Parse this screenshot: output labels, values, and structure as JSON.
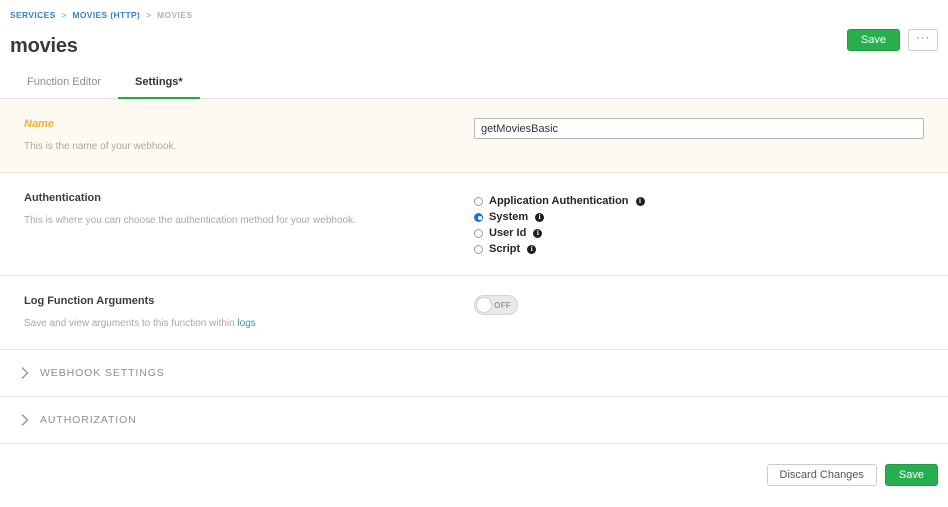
{
  "breadcrumb": {
    "items": [
      {
        "label": "SERVICES",
        "type": "link"
      },
      {
        "label": "MOVIES (HTTP)",
        "type": "link"
      },
      {
        "label": "MOVIES",
        "type": "current"
      }
    ],
    "separator": ">"
  },
  "header": {
    "title": "movies",
    "save_label": "Save",
    "more_label": "···"
  },
  "tabs": [
    {
      "label": "Function Editor",
      "active": false
    },
    {
      "label": "Settings*",
      "active": true
    }
  ],
  "sections": {
    "name": {
      "label": "Name",
      "description": "This is the name of your webhook.",
      "input_value": "getMoviesBasic",
      "input_placeholder": ""
    },
    "authentication": {
      "label": "Authentication",
      "description": "This is where you can choose the authentication method for your webhook.",
      "options": [
        {
          "label": "Application Authentication",
          "selected": false,
          "info": "i"
        },
        {
          "label": "System",
          "selected": true,
          "info": "i"
        },
        {
          "label": "User Id",
          "selected": false,
          "info": "i"
        },
        {
          "label": "Script",
          "selected": false,
          "info": "i"
        }
      ]
    },
    "log_function_arguments": {
      "label": "Log Function Arguments",
      "description_prefix": "Save and view arguments to this function within ",
      "description_link": "logs",
      "toggle_state": "OFF"
    }
  },
  "collapsibles": [
    {
      "label": "WEBHOOK SETTINGS",
      "icon": "chevron-right-icon"
    },
    {
      "label": "AUTHORIZATION",
      "icon": "chevron-right-icon"
    }
  ],
  "footer": {
    "discard_label": "Discard Changes",
    "save_label": "Save"
  },
  "colors": {
    "accent_green": "#27ae4f",
    "tab_underline": "#2ba84a",
    "link_blue": "#3a8fd0",
    "breadcrumb_blue": "#3a7fc1",
    "warn_orange": "#f0ad3c",
    "radio_blue": "#1a73d4",
    "highlight_bg": "#fefaf2"
  }
}
